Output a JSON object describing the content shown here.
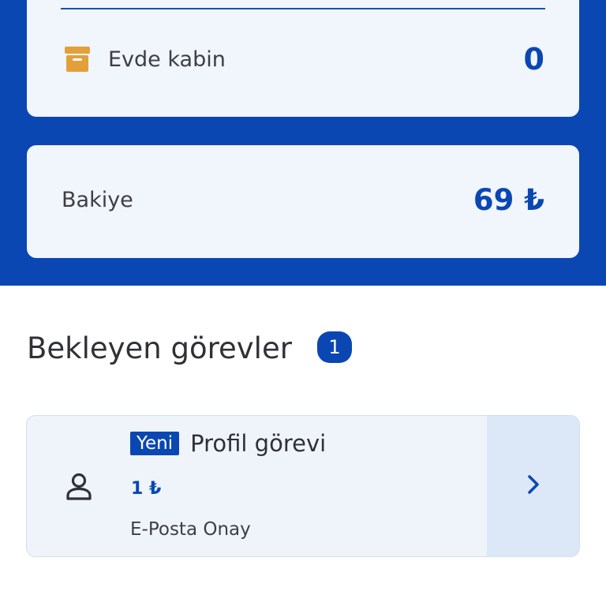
{
  "summary": {
    "home_cabin_label": "Evde kabin",
    "home_cabin_value": "0"
  },
  "balance": {
    "label": "Bakiye",
    "value": "69 ₺"
  },
  "pending_tasks": {
    "title": "Bekleyen görevler",
    "count": "1",
    "items": [
      {
        "badge": "Yeni",
        "title": "Profil görevi",
        "reward": "1 ₺",
        "description": "E-Posta Onay"
      }
    ]
  },
  "colors": {
    "primary": "#0a47b3",
    "card_bg": "#f1f5fc",
    "box_icon": "#e3a03a"
  },
  "icons": {
    "home_cabin": "archive-box-icon",
    "task": "person-icon",
    "arrow": "chevron-right-icon"
  }
}
